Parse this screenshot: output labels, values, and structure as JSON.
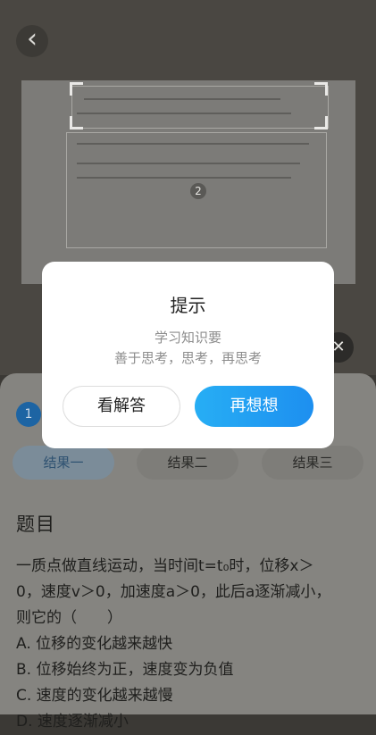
{
  "photo": {
    "badge_number": "2",
    "close_icon": "close-icon",
    "back_icon": "chevron-left-icon"
  },
  "sheet": {
    "step_number": "1",
    "tabs": [
      "结果一",
      "结果二",
      "结果三"
    ],
    "section_title": "题目",
    "question_lines": [
      "一质点做直线运动，当时间t=t₀时，位移x＞",
      "0，速度v＞0，加速度a＞0，此后a逐渐减小，",
      "则它的（　　）",
      "A. 位移的变化越来越快",
      "B. 位移始终为正，速度变为负值",
      "C. 速度的变化越来越慢",
      "D. 速度逐渐减小"
    ]
  },
  "dialog": {
    "title": "提示",
    "line1": "学习知识要",
    "line2": "善于思考，思考，再思考",
    "answer_button": "看解答",
    "rethink_button": "再想想"
  },
  "colors": {
    "accent": "#1d8ff0",
    "accent_light": "#27aef4"
  }
}
